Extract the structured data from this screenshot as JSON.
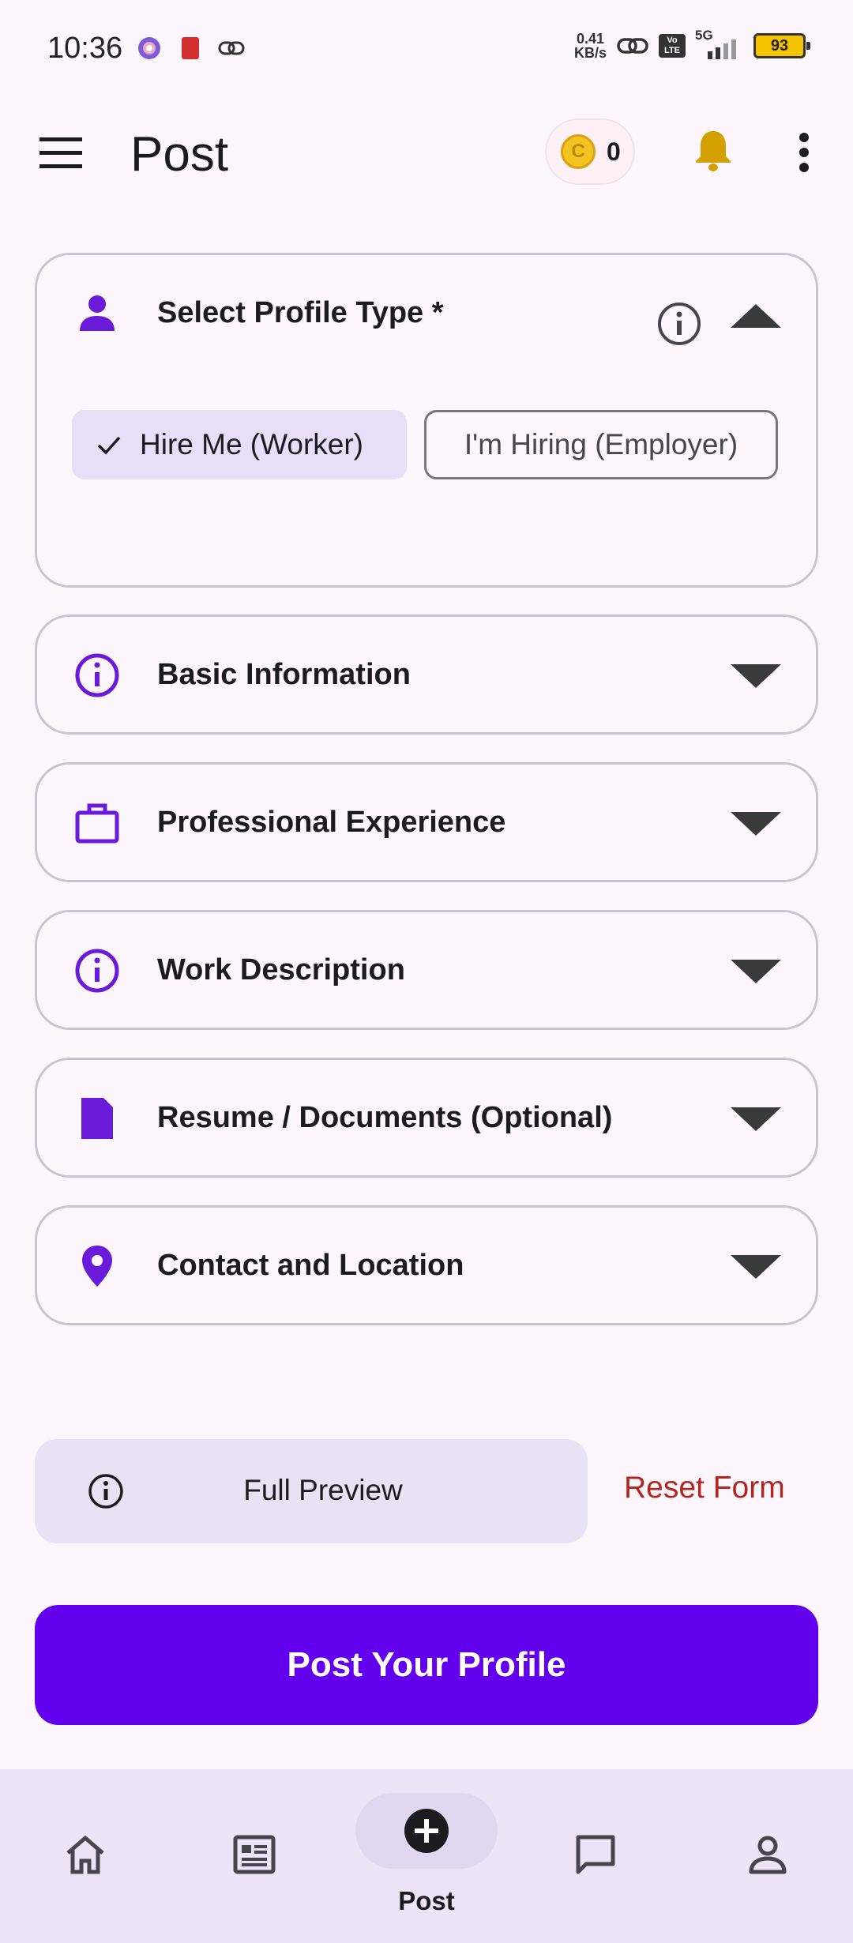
{
  "status_bar": {
    "time": "10:36",
    "net_speed_value": "0.41",
    "net_speed_unit": "KB/s",
    "network": "5G",
    "volte": "Vo LTE",
    "battery": "93"
  },
  "app_bar": {
    "title": "Post",
    "coin_symbol": "C",
    "coin_count": "0",
    "icons": [
      "menu-icon",
      "coin-icon",
      "bell-icon",
      "more-vert-icon"
    ]
  },
  "profile_type": {
    "title": "Select Profile Type *",
    "options": [
      {
        "label": "Hire Me (Worker)",
        "selected": true
      },
      {
        "label": "I'm Hiring (Employer)",
        "selected": false
      }
    ]
  },
  "sections": [
    {
      "title": "Basic Information",
      "icon": "info-icon"
    },
    {
      "title": "Professional Experience",
      "icon": "briefcase-icon"
    },
    {
      "title": "Work Description",
      "icon": "info-icon"
    },
    {
      "title": "Resume / Documents (Optional)",
      "icon": "document-icon"
    },
    {
      "title": "Contact and Location",
      "icon": "location-pin-icon"
    }
  ],
  "actions": {
    "preview": "Full Preview",
    "reset": "Reset Form",
    "submit": "Post Your Profile"
  },
  "bottom_nav": {
    "active_label": "Post",
    "items": [
      "home-icon",
      "news-icon",
      "add-circle-icon",
      "chat-icon",
      "profile-icon"
    ]
  },
  "colors": {
    "primary": "#6200ee",
    "icon_purple": "#6a1bd9",
    "chip_selected": "#e8def8",
    "reset_red": "#b3261e",
    "nav_bg": "#ede4f7",
    "bell": "#d4a000"
  }
}
